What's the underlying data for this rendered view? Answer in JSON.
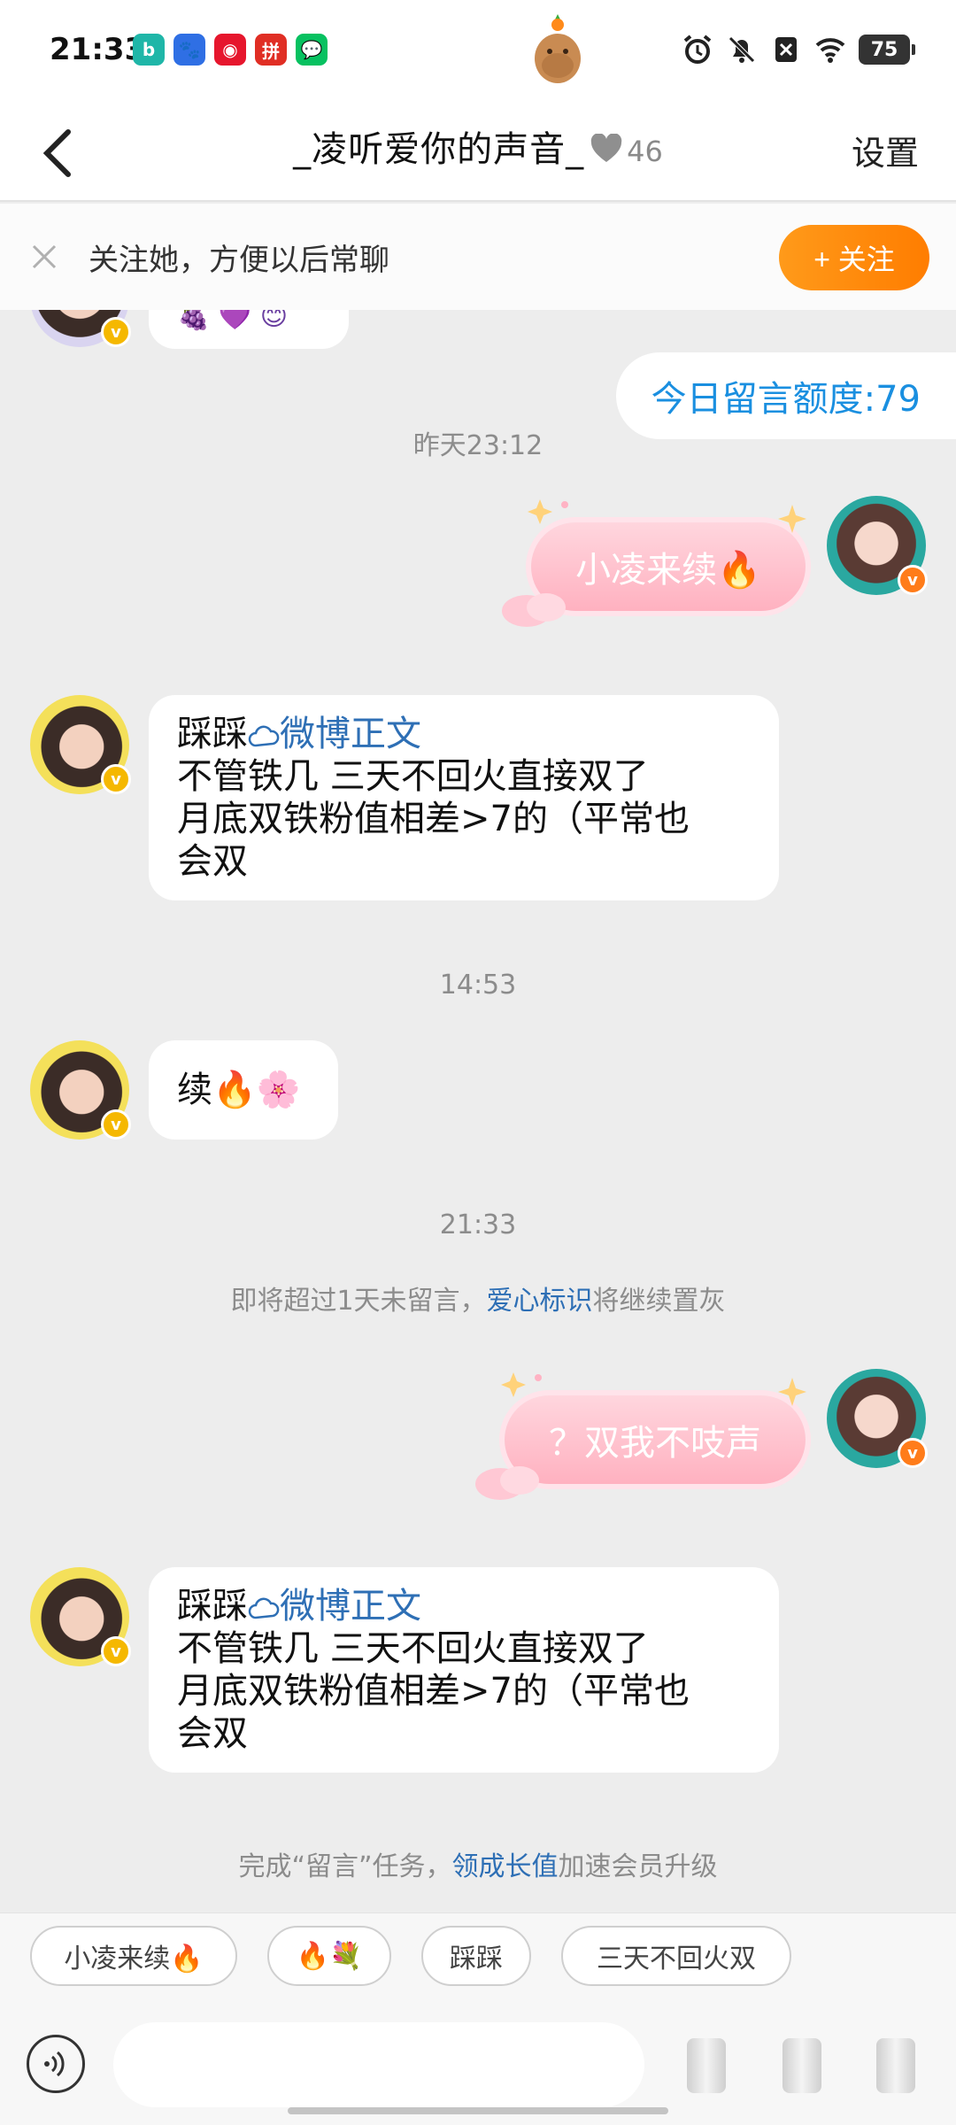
{
  "status_bar": {
    "time": "21:33",
    "battery": "75",
    "apps": [
      {
        "name": "b",
        "color": "#1fb6a8"
      },
      {
        "name": "du",
        "color": "#2f6fe4"
      },
      {
        "name": "wb",
        "color": "#e6162d"
      },
      {
        "name": "pdd",
        "color": "#e02e24"
      },
      {
        "name": "wx",
        "color": "#07c160"
      }
    ]
  },
  "header": {
    "back_icon": "chevron-left-icon",
    "title": "_凌听爱你的声音_",
    "heart_count": "46",
    "settings_label": "设置"
  },
  "follow_bar": {
    "text": "关注她，方便以后常聊",
    "button_label": "+ 关注"
  },
  "chat": {
    "quota_text": "今日留言额度:79",
    "ts_1": "昨天23:12",
    "me_msg_1": "小凌来续🔥",
    "them_msg_1": {
      "prefix": "踩踩",
      "link": "微博正文",
      "line1": "不管铁几 三天不回火直接双了",
      "line2": "月底双铁粉值相差>7的（平常也",
      "line3": "会双"
    },
    "ts_2": "14:53",
    "them_msg_2": "续🔥🌸",
    "ts_3": "21:33",
    "sys_1_pre": "即将超过1天未留言，",
    "sys_1_link": "爱心标识",
    "sys_1_post": "将继续置灰",
    "me_msg_2": "？双我不吱声",
    "them_msg_3": {
      "prefix": "踩踩",
      "link": "微博正文",
      "line1": "不管铁几 三天不回火直接双了",
      "line2": "月底双铁粉值相差>7的（平常也",
      "line3": "会双"
    },
    "sys_2_pre": "完成“留言”任务，",
    "sys_2_link": "领成长值",
    "sys_2_post": "加速会员升级"
  },
  "quick_replies": [
    "小凌来续🔥",
    "🔥💐",
    "踩踩",
    "三天不回火双"
  ],
  "input": {
    "placeholder": "",
    "voice_icon": "voice-wave-icon"
  },
  "colors": {
    "accent_orange": "#ff8a00",
    "link_blue": "#2e6fb5",
    "quota_blue": "#1a8fe0",
    "pink_bubble": "#ffb1c0"
  }
}
